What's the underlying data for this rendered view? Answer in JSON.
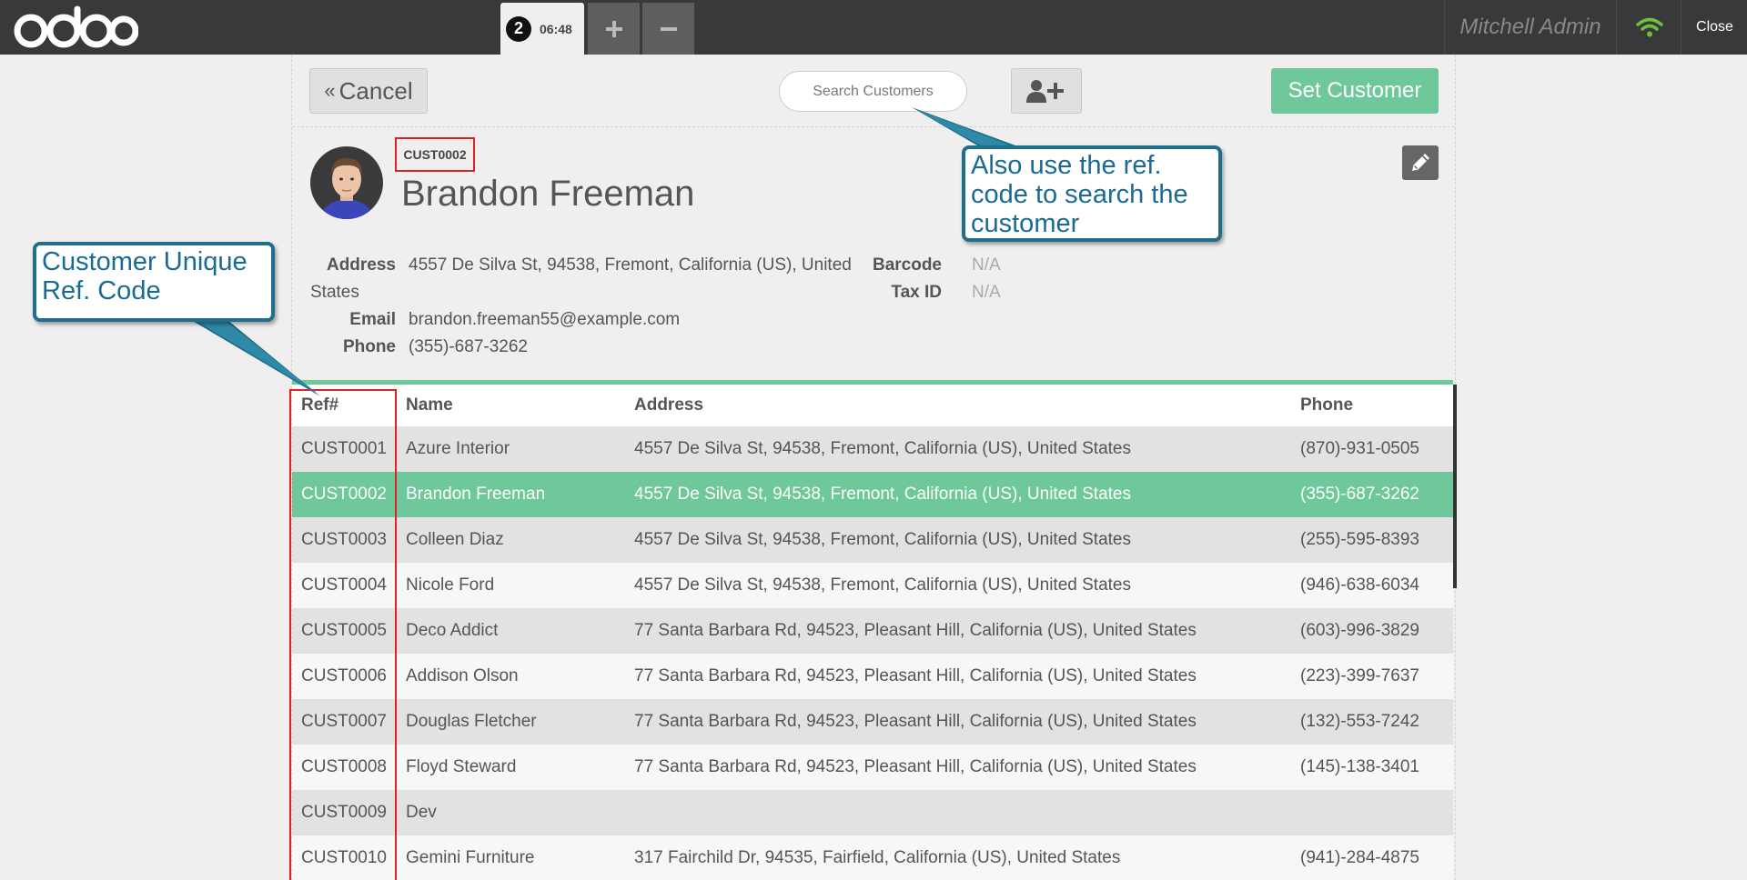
{
  "topbar": {
    "logo_text": "odoo",
    "order_tab": {
      "number": "2",
      "time": "06:48"
    },
    "add_order_icon": "plus-icon",
    "remove_order_icon": "minus-icon",
    "user_name": "Mitchell Admin",
    "wifi_icon": "wifi-icon",
    "wifi_color": "#6ec040",
    "close_label": "Close"
  },
  "screen_head": {
    "cancel_label": "Cancel",
    "search_placeholder": "Search Customers",
    "new_customer_icon": "user-plus-icon",
    "set_customer_label": "Set Customer"
  },
  "customer": {
    "ref": "CUST0002",
    "name": "Brandon Freeman",
    "address_label": "Address",
    "address_value": "4557 De Silva St, 94538, Fremont, California (US), United",
    "address_value_cont": "States",
    "email_label": "Email",
    "email_value": "brandon.freeman55@example.com",
    "phone_label": "Phone",
    "phone_value": "(355)-687-3262",
    "barcode_label": "Barcode",
    "barcode_value": "N/A",
    "taxid_label": "Tax ID",
    "taxid_value": "N/A",
    "edit_icon": "pencil-icon"
  },
  "table": {
    "headers": [
      "Ref#",
      "Name",
      "Address",
      "Phone"
    ],
    "rows": [
      {
        "ref": "CUST0001",
        "name": "Azure Interior",
        "address": "4557 De Silva St, 94538, Fremont, California (US), United States",
        "phone": "(870)-931-0505"
      },
      {
        "ref": "CUST0002",
        "name": "Brandon Freeman",
        "address": "4557 De Silva St, 94538, Fremont, California (US), United States",
        "phone": "(355)-687-3262",
        "selected": true
      },
      {
        "ref": "CUST0003",
        "name": "Colleen Diaz",
        "address": "4557 De Silva St, 94538, Fremont, California (US), United States",
        "phone": "(255)-595-8393"
      },
      {
        "ref": "CUST0004",
        "name": "Nicole Ford",
        "address": "4557 De Silva St, 94538, Fremont, California (US), United States",
        "phone": "(946)-638-6034"
      },
      {
        "ref": "CUST0005",
        "name": "Deco Addict",
        "address": "77 Santa Barbara Rd, 94523, Pleasant Hill, California (US), United States",
        "phone": "(603)-996-3829"
      },
      {
        "ref": "CUST0006",
        "name": "Addison Olson",
        "address": "77 Santa Barbara Rd, 94523, Pleasant Hill, California (US), United States",
        "phone": "(223)-399-7637"
      },
      {
        "ref": "CUST0007",
        "name": "Douglas Fletcher",
        "address": "77 Santa Barbara Rd, 94523, Pleasant Hill, California (US), United States",
        "phone": "(132)-553-7242"
      },
      {
        "ref": "CUST0008",
        "name": "Floyd Steward",
        "address": "77 Santa Barbara Rd, 94523, Pleasant Hill, California (US), United States",
        "phone": "(145)-138-3401"
      },
      {
        "ref": "CUST0009",
        "name": "Dev",
        "address": "",
        "phone": ""
      },
      {
        "ref": "CUST0010",
        "name": "Gemini Furniture",
        "address": "317 Fairchild Dr, 94535, Fairfield, California (US), United States",
        "phone": "(941)-284-4875"
      }
    ]
  },
  "annotations": {
    "ref_code_callout": "Customer Unique Ref. Code",
    "search_callout": "Also use the ref. code to search the customer"
  },
  "colors": {
    "topbar_bg": "#393939",
    "accent_green": "#6ec89b",
    "annotation_red": "#dd2222",
    "callout_border": "#1f6f8b",
    "callout_text": "#1a6b94"
  }
}
